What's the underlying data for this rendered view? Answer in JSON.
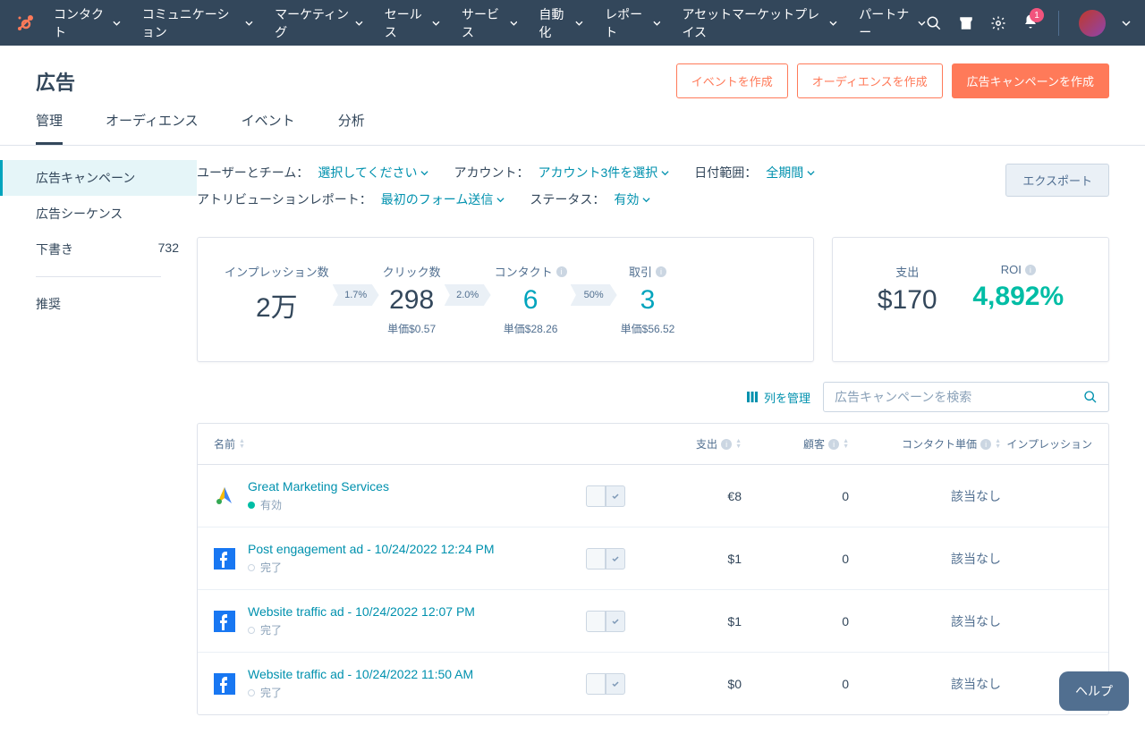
{
  "nav": {
    "items": [
      "コンタクト",
      "コミュニケーション",
      "マーケティング",
      "セールス",
      "サービス",
      "自動化",
      "レポート",
      "アセットマーケットプレイス",
      "パートナー"
    ],
    "notif_count": "1"
  },
  "header": {
    "title": "広告",
    "btn_event": "イベントを作成",
    "btn_audience": "オーディエンスを作成",
    "btn_campaign": "広告キャンペーンを作成"
  },
  "tabs": [
    "管理",
    "オーディエンス",
    "イベント",
    "分析"
  ],
  "sidebar": {
    "items": [
      {
        "label": "広告キャンペーン",
        "count": "",
        "active": true
      },
      {
        "label": "広告シーケンス",
        "count": ""
      },
      {
        "label": "下書き",
        "count": "732"
      }
    ],
    "recommended": "推奨"
  },
  "filters": {
    "user_label": "ユーザーとチーム：",
    "user_val": "選択してください",
    "account_label": "アカウント：",
    "account_val": "アカウント3件を選択",
    "date_label": "日付範囲：",
    "date_val": "全期間",
    "attr_label": "アトリビューションレポート：",
    "attr_val": "最初のフォーム送信",
    "status_label": "ステータス：",
    "status_val": "有効",
    "export": "エクスポート"
  },
  "metrics": {
    "impressions": {
      "label": "インプレッション数",
      "value": "2万"
    },
    "arrow1": "1.7%",
    "clicks": {
      "label": "クリック数",
      "value": "298",
      "sub": "単価$0.57"
    },
    "arrow2": "2.0%",
    "contacts": {
      "label": "コンタクト",
      "value": "6",
      "sub": "単価$28.26"
    },
    "arrow3": "50%",
    "deals": {
      "label": "取引",
      "value": "3",
      "sub": "単価$56.52"
    },
    "spend": {
      "label": "支出",
      "value": "$170"
    },
    "roi": {
      "label": "ROI",
      "value": "4,892%"
    }
  },
  "table_controls": {
    "manage_cols": "列を管理",
    "search_placeholder": "広告キャンペーンを検索"
  },
  "columns": {
    "name": "名前",
    "spend": "支出",
    "customers": "顧客",
    "cpc": "コンタクト単価",
    "impressions": "インプレッション"
  },
  "rows": [
    {
      "icon": "google",
      "title": "Great Marketing Services",
      "status": "有効",
      "status_type": "active",
      "spend": "€8",
      "cust": "0",
      "cpc": "該当なし"
    },
    {
      "icon": "facebook",
      "title": "Post engagement ad - 10/24/2022 12:24 PM",
      "status": "完了",
      "status_type": "done",
      "spend": "$1",
      "cust": "0",
      "cpc": "該当なし"
    },
    {
      "icon": "facebook",
      "title": "Website traffic ad - 10/24/2022 12:07 PM",
      "status": "完了",
      "status_type": "done",
      "spend": "$1",
      "cust": "0",
      "cpc": "該当なし"
    },
    {
      "icon": "facebook",
      "title": "Website traffic ad - 10/24/2022 11:50 AM",
      "status": "完了",
      "status_type": "done",
      "spend": "$0",
      "cust": "0",
      "cpc": "該当なし"
    }
  ],
  "help": "ヘルプ"
}
